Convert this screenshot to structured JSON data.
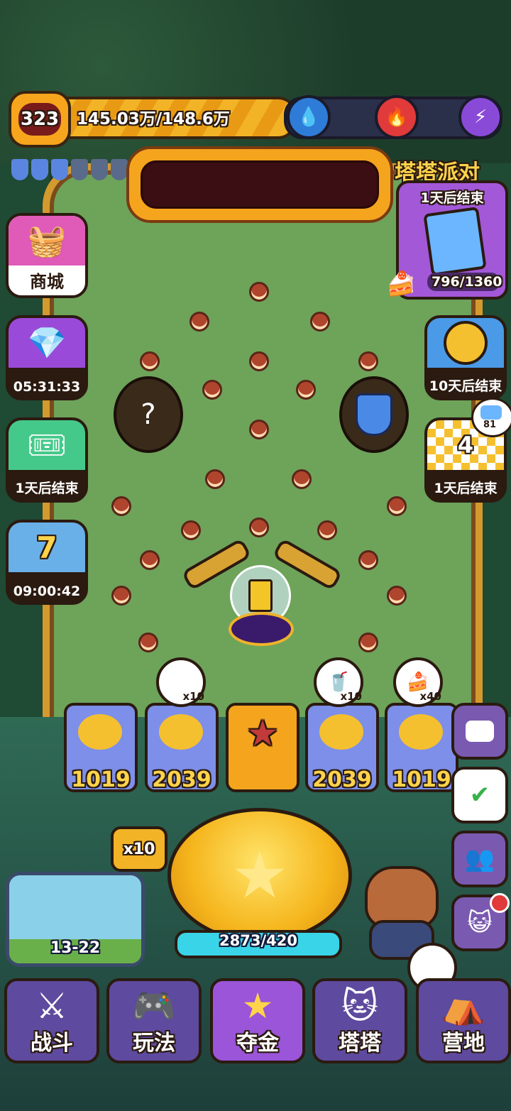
{
  "player": {
    "level": "323",
    "exp_text": "145.03万/148.6万"
  },
  "resources": [
    "water-drop-icon",
    "fire-drop-icon",
    "lightning-icon"
  ],
  "event": {
    "title": "塔塔派对",
    "countdown": "1天后结束",
    "progress": "796/1360"
  },
  "left_buttons": [
    {
      "name": "shop-button",
      "label": "商城",
      "icon": "shop-basket-icon"
    },
    {
      "name": "gem-box-button",
      "label": "05:31:33",
      "icon": "gem-box-icon"
    },
    {
      "name": "ticket-event-button",
      "label": "1天后结束",
      "icon": "ticket-icon"
    },
    {
      "name": "daily-calendar-button",
      "label": "09:00:42",
      "icon": "calendar-icon",
      "day": "7"
    }
  ],
  "right_buttons": [
    {
      "name": "cat-coin-event-button",
      "label": "10天后结束",
      "icon": "cat-coin-icon"
    },
    {
      "name": "race-flag-event-button",
      "label": "1天后结束",
      "icon": "checker-flag-icon",
      "count": "4",
      "badge": "81"
    }
  ],
  "slots": [
    {
      "value": "1019",
      "bubble": null
    },
    {
      "value": "2039",
      "bubble": {
        "icon": "ticket-icon",
        "mult": "x10"
      }
    },
    {
      "value": "",
      "bubble": null,
      "mystery": true
    },
    {
      "value": "2039",
      "bubble": {
        "icon": "energy-drink-icon",
        "mult": "x10"
      }
    },
    {
      "value": "1019",
      "bubble": {
        "icon": "cake-icon",
        "mult": "x40"
      }
    }
  ],
  "launcher": {
    "multiplier": "x10",
    "progress": "2873/420"
  },
  "stage": {
    "label": "13-22"
  },
  "nav": [
    {
      "name": "nav-battle",
      "label": "战斗",
      "icon": "⚔"
    },
    {
      "name": "nav-gameplay",
      "label": "玩法",
      "icon": "🎮"
    },
    {
      "name": "nav-gold",
      "label": "夺金",
      "icon": "★",
      "active": true
    },
    {
      "name": "nav-tata",
      "label": "塔塔",
      "icon": "🐱"
    },
    {
      "name": "nav-camp",
      "label": "营地",
      "icon": "⛺"
    }
  ]
}
